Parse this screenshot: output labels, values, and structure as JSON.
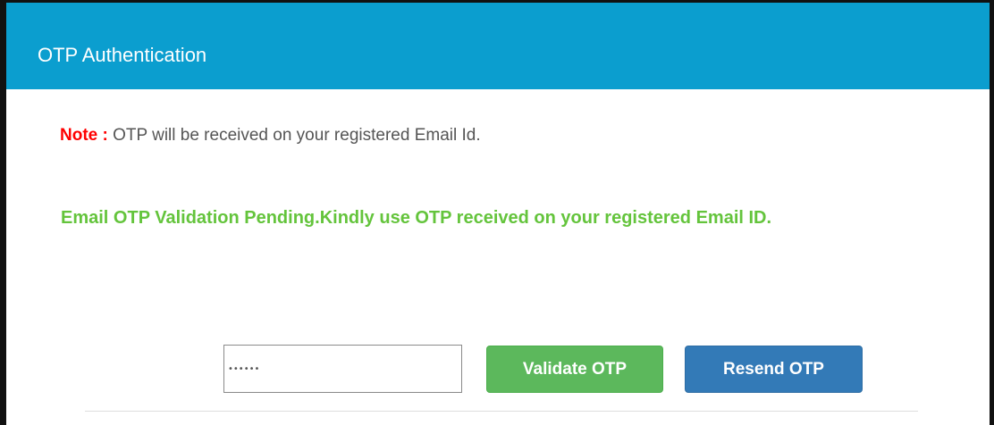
{
  "header": {
    "title": "OTP Authentication"
  },
  "note": {
    "label": "Note :",
    "text": "OTP will be received on your registered Email Id."
  },
  "status": {
    "message": "Email OTP Validation Pending.Kindly use OTP received on your registered Email ID."
  },
  "otp_input": {
    "value": "••••••"
  },
  "buttons": {
    "validate_label": "Validate OTP",
    "resend_label": "Resend OTP"
  },
  "colors": {
    "header_bg": "#0b9ecf",
    "note_label": "#ff0000",
    "status_text": "#64c43c",
    "validate_button": "#5cb85c",
    "resend_button": "#337ab7"
  }
}
